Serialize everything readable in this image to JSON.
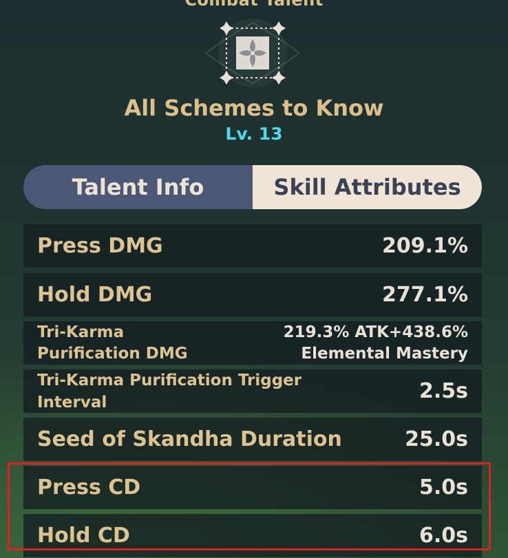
{
  "header": {
    "title": "Combat Talent"
  },
  "skill": {
    "name": "All Schemes to Know",
    "level": "Lv. 13"
  },
  "tabs": [
    {
      "label": "Talent Info",
      "active": false
    },
    {
      "label": "Skill Attributes",
      "active": true
    }
  ],
  "attributes": [
    {
      "label": "Press DMG",
      "value": "209.1%"
    },
    {
      "label": "Hold DMG",
      "value": "277.1%"
    },
    {
      "label_line1": "Tri-Karma",
      "label_line2": "Purification DMG",
      "value_line1": "219.3% ATK+438.6%",
      "value_line2": "Elemental Mastery"
    },
    {
      "label_line1": "Tri-Karma Purification Trigger",
      "label_line2": "Interval",
      "value": "2.5s"
    },
    {
      "label": "Seed of Skandha Duration",
      "value": "25.0s"
    },
    {
      "label": "Press CD",
      "value": "5.0s"
    },
    {
      "label": "Hold CD",
      "value": "6.0s"
    }
  ],
  "colors": {
    "accent_gold": "#dbc08b",
    "level_cyan": "#4fd8ee",
    "tab_inactive_bg": "#4b5774",
    "tab_active_bg": "#efe6d8",
    "highlight_red": "#e02020"
  },
  "icons": {
    "talent_emblem": "talent-emblem-icon"
  }
}
